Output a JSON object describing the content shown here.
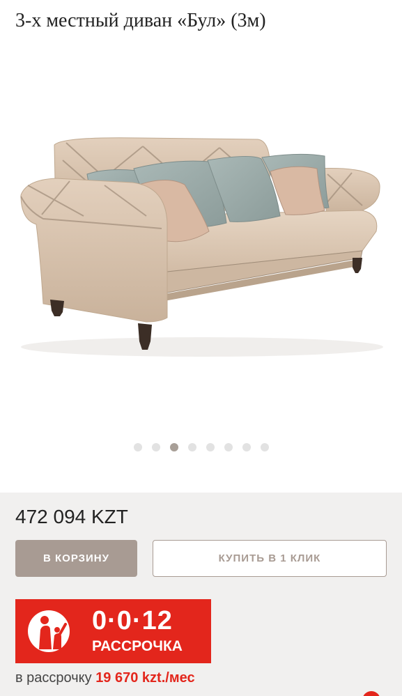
{
  "product": {
    "title": "3-х местный диван «Бул» (3м)"
  },
  "gallery": {
    "image_alt": "sofa",
    "dots_total": 8,
    "active_index": 2
  },
  "pricing": {
    "price": "472 094 KZT"
  },
  "actions": {
    "cart_label": "В КОРЗИНУ",
    "oneclick_label": "КУПИТЬ В 1 КЛИК"
  },
  "installment": {
    "banner_code": "0·0·12",
    "banner_label": "РАССРОЧКА",
    "prefix": "в рассрочку ",
    "amount": "19 670 kzt./мес"
  },
  "colors": {
    "accent_brown": "#a89b93",
    "panel_bg": "#f1f0ef",
    "promo_red": "#e3261c",
    "sofa_fabric": "#d8c3ae",
    "pillow_blue": "#9aa9a8"
  }
}
